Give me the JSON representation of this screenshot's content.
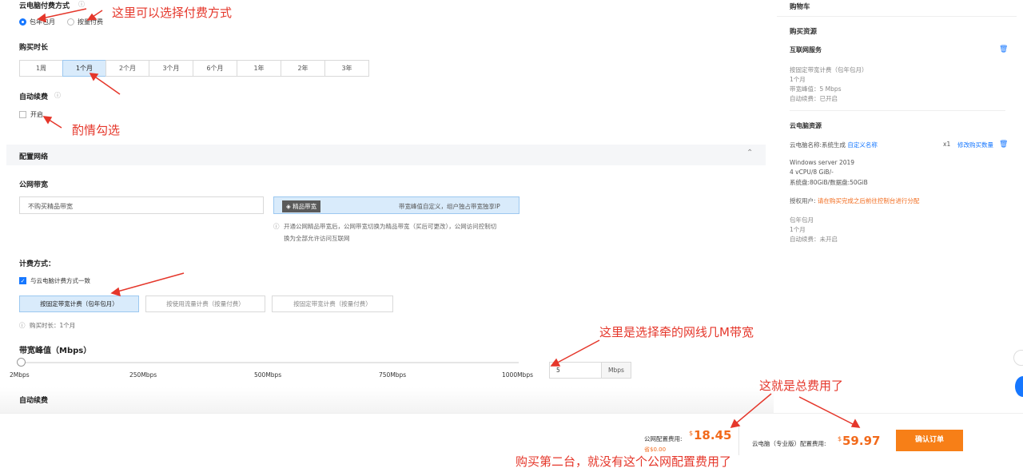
{
  "billing": {
    "label": "云电脑付费方式",
    "options": [
      "包年包月",
      "按量付费"
    ]
  },
  "duration": {
    "label": "购买时长",
    "options": [
      "1周",
      "1个月",
      "2个月",
      "3个月",
      "6个月",
      "1年",
      "2年",
      "3年"
    ],
    "selected": "1个月"
  },
  "auto_renew": {
    "label": "自动续费",
    "checkbox": "开启"
  },
  "network": {
    "section": "配置网络",
    "bandwidth_label": "公网带宽",
    "no_premium": "不购买精品带宽",
    "premium_tag": "精品带宽",
    "premium_desc": "带宽峰值自定义，组户独占带宽独享IP",
    "info_line1": "开通公网精品带宽后，公网带宽切换为精品带宽（买后可更改），公网访问控制切",
    "info_line2": "换为全部允许访问互联网",
    "billing_method_label": "计费方式：",
    "same_as_pc": "与云电脑计费方式一致",
    "methods": [
      "按固定带宽计费（包年包月）",
      "按使用流量计费（按量付费）",
      "按固定带宽计费（按量付费）"
    ],
    "purchase_duration": "购买时长：1个月",
    "peak_label": "带宽峰值（Mbps）",
    "slider_ticks": [
      "2Mbps",
      "250Mbps",
      "500Mbps",
      "750Mbps",
      "1000Mbps"
    ],
    "slider_value": 5,
    "peak_input": "5",
    "unit": "Mbps",
    "auto_renew2": "自动续费"
  },
  "cart": {
    "title": "购物车",
    "buy_resources": "购买资源",
    "internet": {
      "title": "互联网服务",
      "lines": [
        "按固定带宽计费（包年包月）",
        "1个月",
        "带宽峰值：5 Mbps",
        "自动续费：已开启"
      ]
    },
    "pc": {
      "title": "云电脑资源",
      "name": "云电脑名称:系统生成",
      "custom_name": "自定义名称",
      "qty": "x1",
      "edit_qty": "修改购买数量",
      "specs": [
        "Windows server 2019",
        "4 vCPU/8 GiB/-",
        "系统盘:80GiB/数据盘:50GiB"
      ],
      "auth_label": "授权用户:",
      "auth_value": "请在购买完成之后前往控制台进行分配",
      "tail": [
        "包年包月",
        "1个月",
        "自动续费：未开启"
      ]
    }
  },
  "footer": {
    "net_fee_label": "公网配置费用:",
    "currency": "$",
    "net_fee": "18.45",
    "save": "省$0.00",
    "pc_fee_label": "云电脑（专业版）配置费用:",
    "pc_fee": "59.97",
    "confirm": "确认订单"
  },
  "annotations": {
    "a1": "这里可以选择付费方式",
    "a2": "酌情勾选",
    "a3": "这里是选择牵的网线几M带宽",
    "a4": "这就是总费用了",
    "a5": "购买第二台，就没有这个公网配置费用了"
  }
}
